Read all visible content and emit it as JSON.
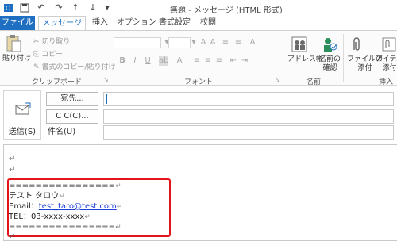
{
  "window": {
    "title": "無題 - メッセージ (HTML 形式)"
  },
  "tabs": [
    {
      "label": "ファイル"
    },
    {
      "label": "メッセージ"
    },
    {
      "label": "挿入"
    },
    {
      "label": "オプション"
    },
    {
      "label": "書式設定"
    },
    {
      "label": "校閲"
    }
  ],
  "ribbon": {
    "clipboard": {
      "paste": "貼り付け",
      "cut": "切り取り",
      "copy": "コピー",
      "format_copy": "書式のコピー/貼り付け",
      "group": "クリップボード"
    },
    "font": {
      "group": "フォント"
    },
    "names": {
      "address_book": "アドレス帳",
      "check_names": "名前の\n確認",
      "group": "名前"
    },
    "insert": {
      "attach_file": "ファイルの\n添付",
      "attach_item": "アイテム\n添付",
      "group": "挿入"
    }
  },
  "header": {
    "send": "送信(S)",
    "to_button": "宛先...",
    "cc_button": "C C(C)...",
    "subject_label": "件名(U)"
  },
  "body": {
    "paragraph_mark": "↵",
    "signature": {
      "separator": "================",
      "name": "テスト タロウ",
      "email_label": "Email：",
      "email": "test_taro@test.com",
      "tel": "TEL：03-xxxx-xxxx"
    }
  },
  "colors": {
    "accent": "#1e6fc1",
    "highlight": "#e3141b",
    "link": "#1e3fd6"
  }
}
